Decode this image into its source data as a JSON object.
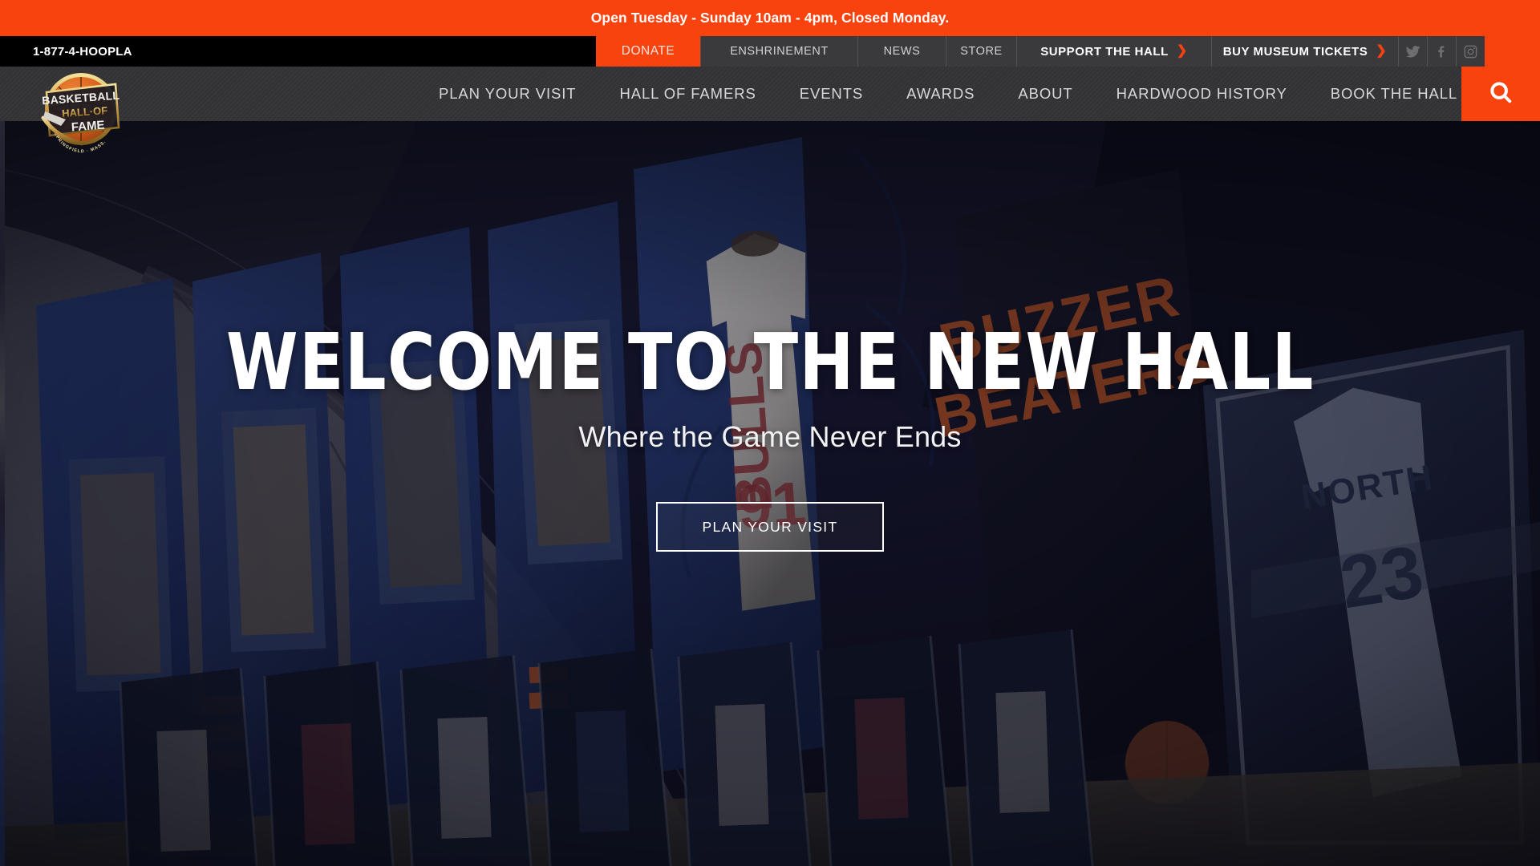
{
  "announcement": {
    "text": "Open Tuesday - Sunday 10am - 4pm, Closed Monday."
  },
  "utility_bar": {
    "phone": "1-877-4-HOOPLA",
    "items": [
      {
        "label": "DONATE",
        "chevron": ""
      },
      {
        "label": "ENSHRINEMENT",
        "chevron": ""
      },
      {
        "label": "NEWS",
        "chevron": ""
      },
      {
        "label": "STORE",
        "chevron": ""
      },
      {
        "label": "SUPPORT THE HALL",
        "chevron": "❯"
      },
      {
        "label": "BUY MUSEUM TICKETS",
        "chevron": "❯"
      }
    ],
    "social": [
      {
        "name": "twitter-icon"
      },
      {
        "name": "facebook-icon"
      },
      {
        "name": "instagram-icon"
      }
    ]
  },
  "main_nav": {
    "links": [
      {
        "label": "PLAN YOUR VISIT"
      },
      {
        "label": "HALL OF FAMERS"
      },
      {
        "label": "EVENTS"
      },
      {
        "label": "AWARDS"
      },
      {
        "label": "ABOUT"
      },
      {
        "label": "HARDWOOD HISTORY"
      },
      {
        "label": "BOOK THE HALL"
      }
    ],
    "search_icon": "search-icon"
  },
  "logo": {
    "line1": "BASKETBALL",
    "line2": "HALL·OF",
    "line3": "FAME",
    "city": "SPRINGFIELD · MASS."
  },
  "hero": {
    "title": "WELCOME TO THE NEW HALL",
    "subtitle": "Where the Game Never Ends",
    "button_label": "PLAN YOUR VISIT",
    "banner_text_right": "BUZZER BEATERS",
    "jersey_team": "BULLS",
    "jersey_number": "91",
    "jersey_team_right": "NORTH",
    "jersey_number_right": "23"
  },
  "colors": {
    "brand_orange": "#f9430f",
    "util_gray": "#3a3a3c",
    "nav_gray": "#333335",
    "black": "#000000",
    "white": "#ffffff"
  }
}
